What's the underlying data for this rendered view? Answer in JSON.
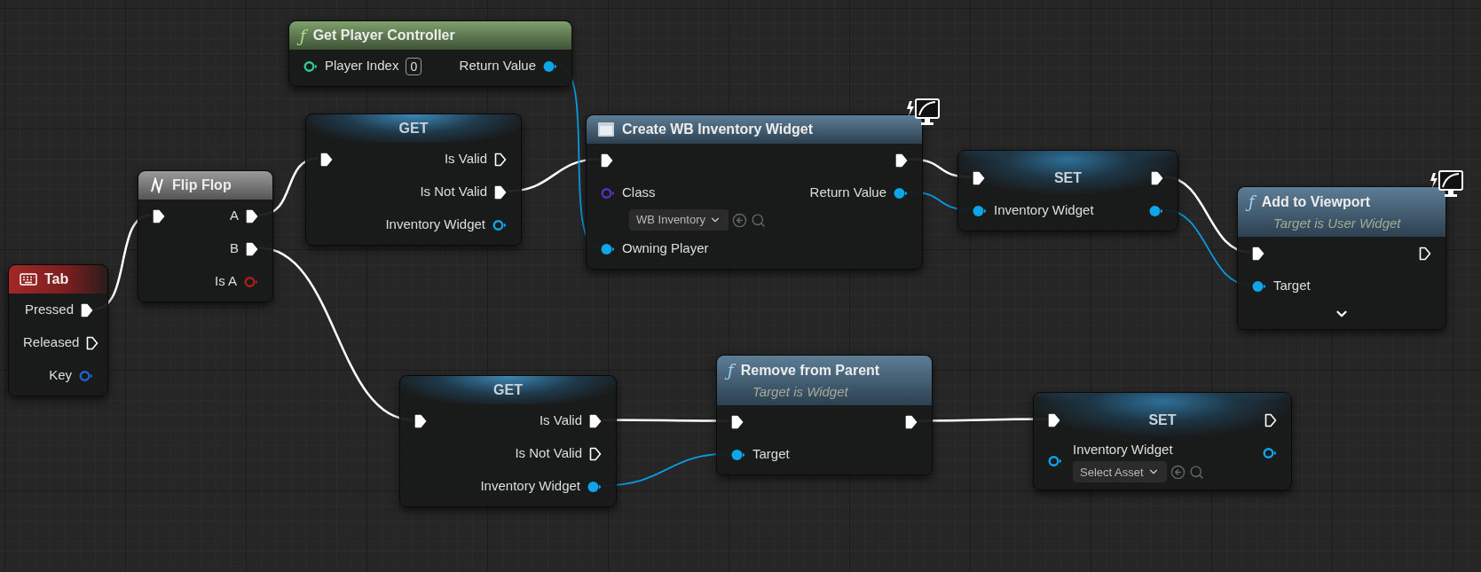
{
  "nodes": [
    {
      "kind": "event",
      "title": "Tab",
      "rows": [
        {
          "right": {
            "label": "Pressed",
            "kind": "exec",
            "connected": true
          }
        },
        {
          "right": {
            "label": "Released",
            "kind": "exec",
            "connected": false
          }
        },
        {
          "right": {
            "label": "Key",
            "kind": "data",
            "connected": false,
            "color": "#1e63d6"
          }
        }
      ]
    },
    {
      "kind": "macro",
      "title": "Flip Flop",
      "rows": [
        {
          "left": {
            "kind": "exec",
            "connected": true
          },
          "right": {
            "label": "A",
            "kind": "exec",
            "connected": true
          }
        },
        {
          "right": {
            "label": "B",
            "kind": "exec",
            "connected": true
          }
        },
        {
          "right": {
            "label": "Is A",
            "kind": "data",
            "connected": false,
            "color": "#b01c1c"
          }
        }
      ]
    },
    {
      "kind": "pure_function",
      "glyph": "ƒ",
      "title": "Get Player Controller",
      "rows": [
        {
          "left": {
            "label": "Player Index",
            "kind": "data",
            "connected": false,
            "color": "#2ec99a",
            "widget": {
              "kind": "number",
              "value": "0"
            }
          },
          "right": {
            "label": "Return Value",
            "kind": "data",
            "connected": true,
            "color": "#0ea5e9"
          }
        }
      ]
    },
    {
      "kind": "variable_get",
      "title": "GET",
      "rows": [
        {
          "left": {
            "kind": "exec",
            "connected": true
          },
          "right": {
            "label": "Is Valid",
            "kind": "exec",
            "connected": false
          }
        },
        {
          "right": {
            "label": "Is Not Valid",
            "kind": "exec",
            "connected": true
          }
        },
        {
          "right": {
            "label": "Inventory Widget",
            "kind": "data",
            "connected": false,
            "color": "#0ea5e9"
          }
        }
      ]
    },
    {
      "kind": "construct",
      "title": "Create WB Inventory Widget",
      "remote_icon": true,
      "rows": [
        {
          "left": {
            "kind": "exec",
            "connected": true
          },
          "right": {
            "kind": "exec",
            "connected": true
          }
        },
        {
          "left": {
            "label": "Class",
            "kind": "data",
            "connected": false,
            "color": "#5a2fc0",
            "widget": {
              "kind": "asset",
              "value": "WB Inventory"
            }
          },
          "right": {
            "label": "Return Value",
            "kind": "data",
            "connected": true,
            "color": "#0ea5e9"
          }
        },
        {
          "left": {
            "label": "Owning Player",
            "kind": "data",
            "connected": true,
            "color": "#0ea5e9"
          }
        }
      ]
    },
    {
      "kind": "variable_set",
      "title": "SET",
      "rows": [
        {
          "left": {
            "kind": "exec",
            "connected": true
          },
          "right": {
            "kind": "exec",
            "connected": true
          }
        },
        {
          "left": {
            "label": "Inventory Widget",
            "kind": "data",
            "connected": true,
            "color": "#0ea5e9"
          },
          "right": {
            "kind": "data",
            "connected": true,
            "color": "#0ea5e9"
          }
        }
      ]
    },
    {
      "kind": "function",
      "glyph": "ƒ",
      "title": "Add to Viewport",
      "subtitle": "Target is User Widget",
      "remote_icon": true,
      "expandable": true,
      "rows": [
        {
          "left": {
            "kind": "exec",
            "connected": true
          },
          "right": {
            "kind": "exec",
            "connected": false
          }
        },
        {
          "left": {
            "label": "Target",
            "kind": "data",
            "connected": true,
            "color": "#0ea5e9"
          }
        }
      ]
    },
    {
      "kind": "variable_get",
      "title": "GET",
      "rows": [
        {
          "left": {
            "kind": "exec",
            "connected": true
          },
          "right": {
            "label": "Is Valid",
            "kind": "exec",
            "connected": true
          }
        },
        {
          "right": {
            "label": "Is Not Valid",
            "kind": "exec",
            "connected": false
          }
        },
        {
          "right": {
            "label": "Inventory Widget",
            "kind": "data",
            "connected": true,
            "color": "#0ea5e9"
          }
        }
      ]
    },
    {
      "kind": "function",
      "glyph": "ƒ",
      "title": "Remove from Parent",
      "subtitle": "Target is Widget",
      "rows": [
        {
          "left": {
            "kind": "exec",
            "connected": true
          },
          "right": {
            "kind": "exec",
            "connected": true
          }
        },
        {
          "left": {
            "label": "Target",
            "kind": "data",
            "connected": true,
            "color": "#0ea5e9"
          }
        }
      ]
    },
    {
      "kind": "variable_set",
      "title": "SET",
      "rows": [
        {
          "left": {
            "kind": "exec",
            "connected": true
          },
          "right": {
            "kind": "exec",
            "connected": false
          }
        },
        {
          "left": {
            "label": "Inventory Widget",
            "kind": "data",
            "connected": false,
            "color": "#0ea5e9",
            "widget": {
              "kind": "asset",
              "value": "Select Asset"
            }
          },
          "right": {
            "kind": "data",
            "connected": false,
            "color": "#0ea5e9"
          }
        }
      ]
    }
  ]
}
